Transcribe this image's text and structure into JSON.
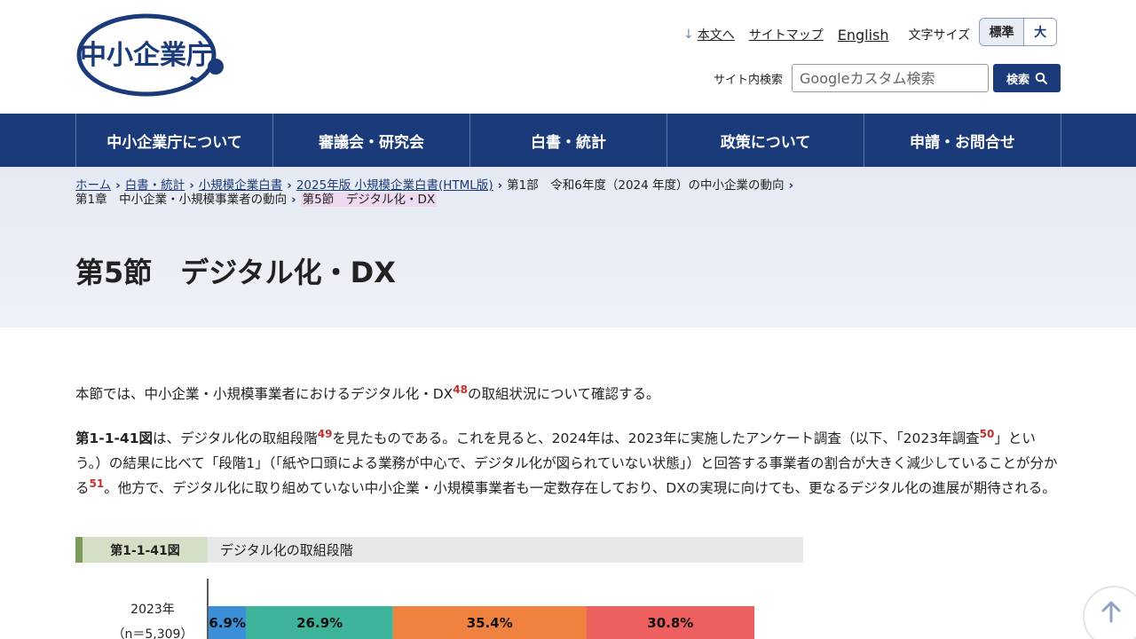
{
  "header": {
    "logo_text": "中小企業庁",
    "skip_link": "本文へ",
    "sitemap": "サイトマップ",
    "english": "English",
    "font_size_label": "文字サイズ",
    "font_size_standard": "標準",
    "font_size_large": "大",
    "search_label": "サイト内検索",
    "search_placeholder": "Googleカスタム検索",
    "search_button": "検索"
  },
  "nav": [
    "中小企業庁について",
    "審議会・研究会",
    "白書・統計",
    "政策について",
    "申請・お問合せ"
  ],
  "breadcrumb": {
    "home": "ホーム",
    "l1": "白書・統計",
    "l2": "小規模企業白書",
    "l3": "2025年版 小規模企業白書(HTML版)",
    "l4": "第1部　令和6年度（2024 年度）の中小企業の動向",
    "l5": "第1章　中小企業・小規模事業者の動向",
    "current": "第5節　デジタル化・DX"
  },
  "page_title": "第5節　デジタル化・DX",
  "body": {
    "p1_a": "本節では、中小企業・小規模事業者におけるデジタル化・DX",
    "p1_fn": "48",
    "p1_b": "の取組状況について確認する。",
    "p2_bold": "第1-1-41図",
    "p2_a": "は、デジタル化の取組段階",
    "p2_fn1": "49",
    "p2_b": "を見たものである。これを見ると、2024年は、2023年に実施したアンケート調査（以下、「2023年調査",
    "p2_fn2": "50",
    "p2_c": "」という。）の結果に比べて「段階1」（「紙や口頭による業務が中心で、デジタル化が図られていない状態」）と回答する事業者の割合が大きく減少していることが分かる",
    "p2_fn3": "51",
    "p2_d": "。他方で、デジタル化に取り組めていない中小企業・小規模事業者も一定数存在しており、DXの実現に向けても、更なるデジタル化の進展が期待される。"
  },
  "figure": {
    "tag": "第1-1-41図",
    "title": "デジタル化の取組段階"
  },
  "chart_data": {
    "type": "bar",
    "orientation": "horizontal-stacked",
    "categories": [
      "2023年"
    ],
    "category_notes": [
      "（n＝5,309）"
    ],
    "series": [
      {
        "values": [
          6.9
        ],
        "color": "#3a8fd6"
      },
      {
        "values": [
          26.9
        ],
        "color": "#3db39a"
      },
      {
        "values": [
          35.4
        ],
        "color": "#f08240"
      },
      {
        "values": [
          30.8
        ],
        "color": "#ee5f5f"
      }
    ],
    "value_labels": [
      "6.9%",
      "26.9%",
      "35.4%",
      "30.8%"
    ],
    "xlim": [
      0,
      100
    ]
  },
  "colors": {
    "brand": "#1a3a7a",
    "footnote": "#c03030",
    "fig_tag_bg": "#d5dfc6",
    "fig_tag_accent": "#7d9a58"
  }
}
